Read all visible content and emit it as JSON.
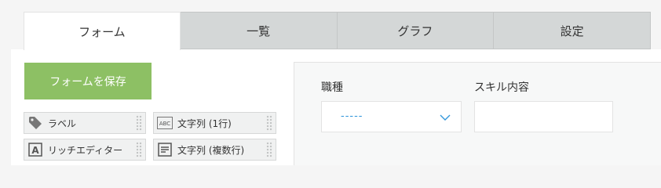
{
  "tabs": [
    {
      "label": "フォーム",
      "active": true
    },
    {
      "label": "一覧",
      "active": false
    },
    {
      "label": "グラフ",
      "active": false
    },
    {
      "label": "設定",
      "active": false
    }
  ],
  "palette": {
    "save_label": "フォームを保存",
    "items": [
      {
        "label": "ラベル",
        "icon": "tag-icon"
      },
      {
        "label": "文字列 (1行)",
        "icon": "abc-text-icon"
      },
      {
        "label": "リッチエディター",
        "icon": "rich-editor-icon"
      },
      {
        "label": "文字列 (複数行)",
        "icon": "multiline-text-icon"
      }
    ]
  },
  "form": {
    "fields": [
      {
        "label": "職種",
        "type": "dropdown",
        "value": "-----"
      },
      {
        "label": "スキル内容",
        "type": "text",
        "value": ""
      }
    ]
  },
  "colors": {
    "save_button": "#8dc064",
    "tab_inactive": "#d4d7d7",
    "dropdown_value": "#3498db"
  }
}
